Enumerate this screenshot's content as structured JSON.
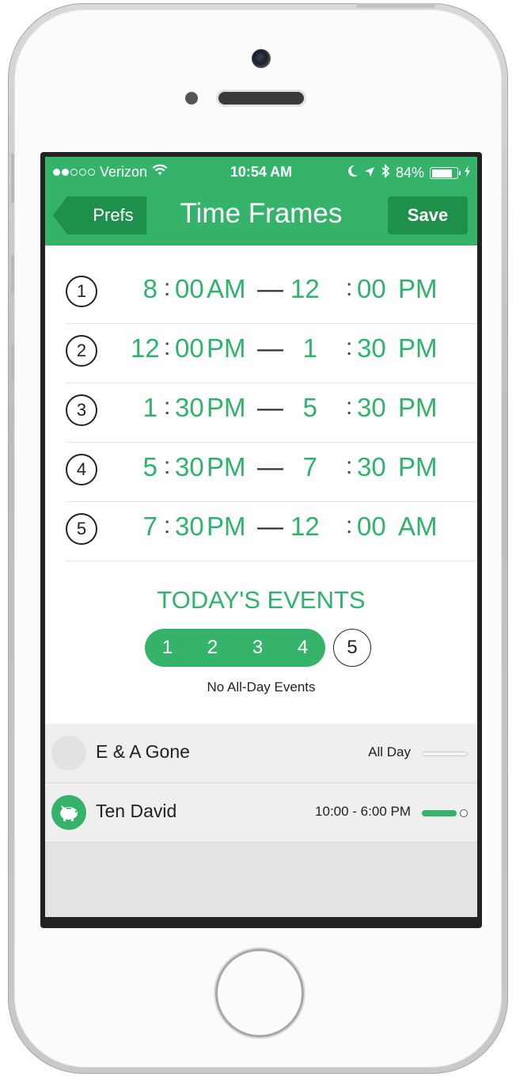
{
  "status_bar": {
    "carrier": "Verizon",
    "time": "10:54 AM",
    "battery": "84%",
    "battery_level": 0.84,
    "signal_bars_filled": 2,
    "signal_bars_total": 5,
    "icons": [
      "wifi-icon",
      "moon-icon",
      "location-arrow-icon",
      "bluetooth-icon",
      "battery-icon",
      "charging-bolt-icon"
    ]
  },
  "nav": {
    "back_label": "Prefs",
    "title": "Time Frames",
    "save_label": "Save"
  },
  "time_frames": [
    {
      "num": "1",
      "start_h": "8",
      "start_m": "00",
      "start_p": "AM",
      "end_h": "12",
      "end_m": "00",
      "end_p": "PM"
    },
    {
      "num": "2",
      "start_h": "12",
      "start_m": "00",
      "start_p": "PM",
      "end_h": "1",
      "end_m": "30",
      "end_p": "PM"
    },
    {
      "num": "3",
      "start_h": "1",
      "start_m": "30",
      "start_p": "PM",
      "end_h": "5",
      "end_m": "30",
      "end_p": "PM"
    },
    {
      "num": "4",
      "start_h": "5",
      "start_m": "30",
      "start_p": "PM",
      "end_h": "7",
      "end_m": "30",
      "end_p": "PM"
    },
    {
      "num": "5",
      "start_h": "7",
      "start_m": "30",
      "start_p": "PM",
      "end_h": "12",
      "end_m": "00",
      "end_p": "AM"
    }
  ],
  "time_separator": ":",
  "range_dash": "—",
  "events": {
    "title": "TODAY'S EVENTS",
    "selected_frames": [
      "1",
      "2",
      "3",
      "4"
    ],
    "unselected_frame": "5",
    "no_all_day": "No All-Day Events",
    "items": [
      {
        "name": "E & A Gone",
        "time": "All Day",
        "icon": "blank-circle-icon",
        "progress": 0.0
      },
      {
        "name": "Ten David",
        "time": "10:00 - 6:00 PM",
        "icon": "piggy-bank-icon",
        "progress": 0.78
      }
    ]
  },
  "colors": {
    "accent": "#35b36a",
    "accent_dark": "#1f8f4c",
    "time_text": "#2fb36a"
  }
}
